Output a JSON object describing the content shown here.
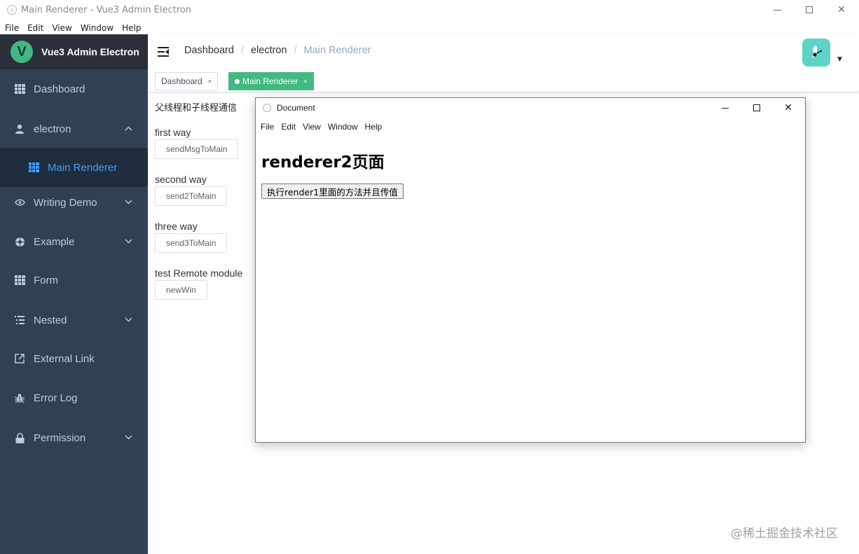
{
  "window": {
    "title": "Main Renderer - Vue3 Admin Electron",
    "minimize": "—",
    "maximize": "☐",
    "close": "✕"
  },
  "menubar": [
    "File",
    "Edit",
    "View",
    "Window",
    "Help"
  ],
  "sidebar": {
    "brand": "Vue3 Admin Electron",
    "logo_letter": "V",
    "items": [
      {
        "label": "Dashboard",
        "icon": "dashboard-grid-icon"
      },
      {
        "label": "electron",
        "icon": "user-icon",
        "expanded": true
      },
      {
        "label": "Main Renderer",
        "icon": "table-grid-icon",
        "active": true
      },
      {
        "label": "Writing Demo",
        "icon": "eye-icon"
      },
      {
        "label": "Example",
        "icon": "example-icon"
      },
      {
        "label": "Form",
        "icon": "form-grid-icon"
      },
      {
        "label": "Nested",
        "icon": "list-icon"
      },
      {
        "label": "External Link",
        "icon": "external-link-icon"
      },
      {
        "label": "Error Log",
        "icon": "bug-icon"
      },
      {
        "label": "Permission",
        "icon": "lock-icon"
      }
    ],
    "colors": {
      "bg": "#304156",
      "active_text": "#409eff"
    }
  },
  "header": {
    "breadcrumb": [
      "Dashboard",
      "electron",
      "Main Renderer"
    ]
  },
  "tags": [
    {
      "label": "Dashboard",
      "active": false
    },
    {
      "label": "Main Renderer",
      "active": true
    }
  ],
  "tag_close": "×",
  "main": {
    "section_title": "父线程和子线程通信",
    "groups": [
      {
        "label": "first way",
        "button": "sendMsgToMain"
      },
      {
        "label": "second way",
        "button": "send2ToMain"
      },
      {
        "label": "three way",
        "button": "send3ToMain"
      },
      {
        "label": "test Remote module",
        "button": "newWin"
      }
    ]
  },
  "child_window": {
    "title": "Document",
    "menubar": [
      "File",
      "Edit",
      "View",
      "Window",
      "Help"
    ],
    "heading": "renderer2页面",
    "button": "执行render1里面的方法并且传值"
  },
  "watermark": "@稀土掘金技术社区",
  "accent": "#42b983"
}
